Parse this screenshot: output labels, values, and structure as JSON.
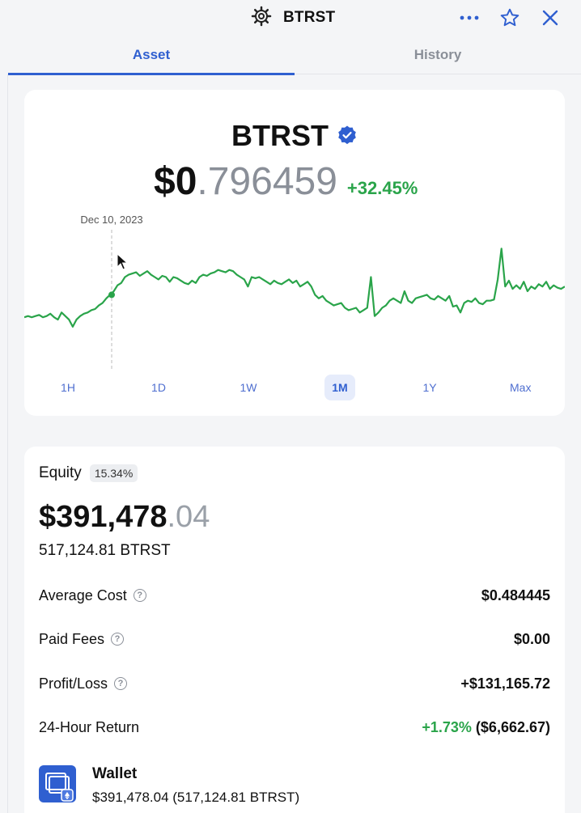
{
  "header": {
    "title": "BTRST",
    "icons": {
      "logo": "gear-logo-icon",
      "more": "more-icon",
      "star": "star-icon",
      "close": "close-icon"
    }
  },
  "tabs": [
    {
      "label": "Asset",
      "active": true
    },
    {
      "label": "History",
      "active": false
    }
  ],
  "asset": {
    "name": "BTRST",
    "verified_icon": "verified-badge-icon",
    "price_main": "$0",
    "price_decimal": ".796459",
    "price_change": "+32.45%"
  },
  "chart_data": {
    "type": "line",
    "hover_label": "Dec 10, 2023",
    "color": "#2aa44a",
    "y_relative": [
      0.74,
      0.73,
      0.74,
      0.73,
      0.72,
      0.74,
      0.73,
      0.71,
      0.74,
      0.76,
      0.7,
      0.73,
      0.76,
      0.82,
      0.76,
      0.73,
      0.71,
      0.7,
      0.68,
      0.67,
      0.64,
      0.62,
      0.58,
      0.55,
      0.52,
      0.47,
      0.45,
      0.4,
      0.38,
      0.37,
      0.36,
      0.39,
      0.37,
      0.35,
      0.38,
      0.4,
      0.42,
      0.39,
      0.4,
      0.44,
      0.4,
      0.41,
      0.43,
      0.45,
      0.46,
      0.43,
      0.45,
      0.4,
      0.38,
      0.39,
      0.37,
      0.36,
      0.34,
      0.35,
      0.36,
      0.34,
      0.35,
      0.38,
      0.4,
      0.42,
      0.48,
      0.4,
      0.41,
      0.4,
      0.42,
      0.44,
      0.46,
      0.43,
      0.45,
      0.46,
      0.44,
      0.42,
      0.45,
      0.43,
      0.48,
      0.46,
      0.44,
      0.48,
      0.55,
      0.58,
      0.56,
      0.6,
      0.62,
      0.64,
      0.63,
      0.62,
      0.66,
      0.68,
      0.67,
      0.66,
      0.7,
      0.68,
      0.66,
      0.4,
      0.73,
      0.7,
      0.66,
      0.64,
      0.6,
      0.58,
      0.6,
      0.62,
      0.52,
      0.6,
      0.62,
      0.58,
      0.57,
      0.56,
      0.55,
      0.58,
      0.59,
      0.56,
      0.58,
      0.6,
      0.56,
      0.65,
      0.64,
      0.7,
      0.62,
      0.6,
      0.61,
      0.58,
      0.62,
      0.63,
      0.6,
      0.6,
      0.59,
      0.42,
      0.16,
      0.48,
      0.43,
      0.5,
      0.47,
      0.5,
      0.44,
      0.52,
      0.48,
      0.5,
      0.46,
      0.48,
      0.44,
      0.5,
      0.47,
      0.49,
      0.5,
      0.48
    ]
  },
  "ranges": [
    {
      "label": "1H",
      "active": false
    },
    {
      "label": "1D",
      "active": false
    },
    {
      "label": "1W",
      "active": false
    },
    {
      "label": "1M",
      "active": true
    },
    {
      "label": "1Y",
      "active": false
    },
    {
      "label": "Max",
      "active": false
    }
  ],
  "equity": {
    "label": "Equity",
    "badge": "15.34%",
    "value_main": "$391,478",
    "value_decimal": ".04",
    "quantity": "517,124.81 BTRST"
  },
  "stats": [
    {
      "label": "Average Cost",
      "value": "$0.484445",
      "help": true
    },
    {
      "label": "Paid Fees",
      "value": "$0.00",
      "help": true
    },
    {
      "label": "Profit/Loss",
      "value": "+$131,165.72",
      "help": true
    },
    {
      "label": "24-Hour Return",
      "value_green": "+1.73%",
      "value_rest": "($6,662.67)",
      "help": false
    }
  ],
  "wallet": {
    "title": "Wallet",
    "value": "$391,478.04 (517,124.81 BTRST)",
    "icon": "wallet-icon"
  }
}
